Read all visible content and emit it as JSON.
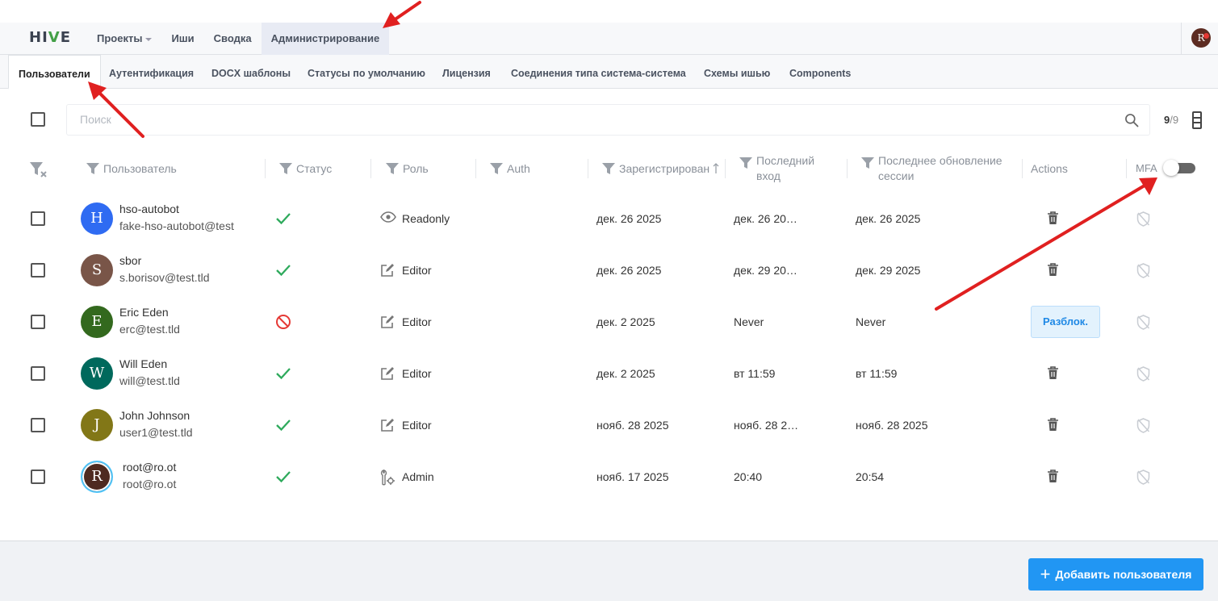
{
  "app": {
    "logo": "HIVE"
  },
  "nav": {
    "projects": "Проекты",
    "issues": "Иши",
    "summary": "Сводка",
    "admin": "Администрирование"
  },
  "user_initial": "R",
  "tabs": [
    "Пользователи",
    "Аутентификация",
    "DOCX шаблоны",
    "Статусы по умолчанию",
    "Лицензия",
    "Соединения типа система-система",
    "Схемы ишью",
    "Components"
  ],
  "search": {
    "placeholder": "Поиск"
  },
  "count": {
    "shown": "9",
    "total": "/9"
  },
  "columns": {
    "user": "Пользователь",
    "status": "Статус",
    "role": "Роль",
    "auth": "Auth",
    "registered": "Зарегистрирован",
    "last_login_1": "Последний",
    "last_login_2": "вход",
    "last_session_1": "Последнее обновление",
    "last_session_2": "сессии",
    "actions": "Actions",
    "mfa": "MFA"
  },
  "mfa_toggle": {
    "on": false
  },
  "users": [
    {
      "initial": "H",
      "color": "#2f6bf2",
      "name": "hso-autobot",
      "email": "fake-hso-autobot@test",
      "status": "active",
      "role": "Readonly",
      "role_icon": "eye-icon",
      "registered": "дек. 26 2025",
      "last_login": "дек. 26 20…",
      "last_session": "дек. 26 2025",
      "action": "delete"
    },
    {
      "initial": "S",
      "color": "#795548",
      "name": "sbor",
      "email": "s.borisov@test.tld",
      "status": "active",
      "role": "Editor",
      "role_icon": "edit-icon",
      "registered": "дек. 26 2025",
      "last_login": "дек. 29 20…",
      "last_session": "дек. 29 2025",
      "action": "delete"
    },
    {
      "initial": "E",
      "color": "#33691e",
      "name": "Eric Eden",
      "email": "erc@test.tld",
      "status": "blocked",
      "role": "Editor",
      "role_icon": "edit-icon",
      "registered": "дек. 2 2025",
      "last_login": "Never",
      "last_session": "Never",
      "action": "unlock",
      "action_label": "Разблок."
    },
    {
      "initial": "W",
      "color": "#00695c",
      "name": "Will Eden",
      "email": "will@test.tld",
      "status": "active",
      "role": "Editor",
      "role_icon": "edit-icon",
      "registered": "дек. 2 2025",
      "last_login": "вт 11:59",
      "last_session": "вт 11:59",
      "action": "delete"
    },
    {
      "initial": "J",
      "color": "#827717",
      "name": "John Johnson",
      "email": "user1@test.tld",
      "status": "active",
      "role": "Editor",
      "role_icon": "edit-icon",
      "registered": "нояб. 28 2025",
      "last_login": "нояб. 28 2…",
      "last_session": "нояб. 28 2025",
      "action": "delete"
    },
    {
      "initial": "R",
      "color": "#4e2a20",
      "name": "root@ro.ot",
      "email": "root@ro.ot",
      "status": "active",
      "role": "Admin",
      "role_icon": "wrench-icon",
      "registered": "нояб. 17 2025",
      "last_login": "20:40",
      "last_session": "20:54",
      "action": "delete",
      "avatar_ring": true
    }
  ],
  "footer": {
    "add_user": "Добавить пользователя"
  },
  "colors": {
    "accent": "#2196f3",
    "success": "#2eaa5c",
    "danger": "#e53935",
    "annotation_arrow": "#e02020"
  }
}
